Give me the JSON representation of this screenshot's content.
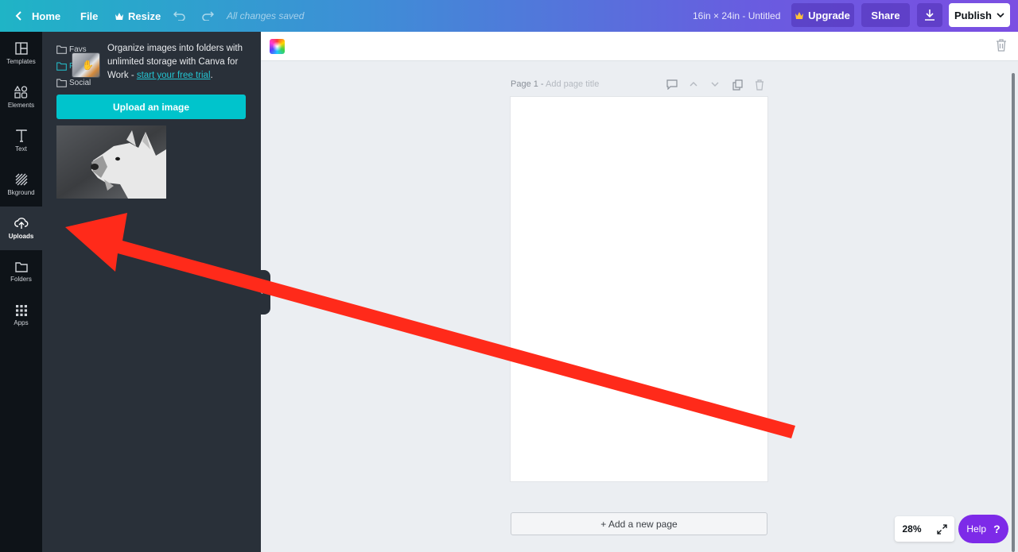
{
  "topbar": {
    "home_label": "Home",
    "file_label": "File",
    "resize_label": "Resize",
    "saved_status": "All changes saved",
    "doc_title": "16in × 24in - Untitled",
    "upgrade_label": "Upgrade",
    "share_label": "Share",
    "publish_label": "Publish"
  },
  "rail": {
    "items": [
      {
        "label": "Templates",
        "icon": "templates-icon"
      },
      {
        "label": "Elements",
        "icon": "elements-icon"
      },
      {
        "label": "Text",
        "icon": "text-icon"
      },
      {
        "label": "Bkground",
        "icon": "background-icon"
      },
      {
        "label": "Uploads",
        "icon": "upload-cloud-icon",
        "active": true
      },
      {
        "label": "Folders",
        "icon": "folder-icon"
      },
      {
        "label": "Apps",
        "icon": "apps-grid-icon"
      }
    ]
  },
  "panel": {
    "folders": [
      "Favs",
      "P",
      "Social"
    ],
    "promo_text": "Organize images into folders with unlimited storage with Canva for Work - ",
    "promo_link": "start your free trial",
    "promo_end": ".",
    "upload_button": "Upload an image"
  },
  "canvas": {
    "page_label": "Page 1 - ",
    "page_title_placeholder": "Add page title",
    "add_page_label": "+ Add a new page"
  },
  "footer": {
    "zoom": "28%",
    "help_label": "Help",
    "help_icon": "?"
  },
  "colors": {
    "accent": "#00c4cc",
    "help": "#7d2ae8",
    "arrow": "#ff2a1a"
  }
}
